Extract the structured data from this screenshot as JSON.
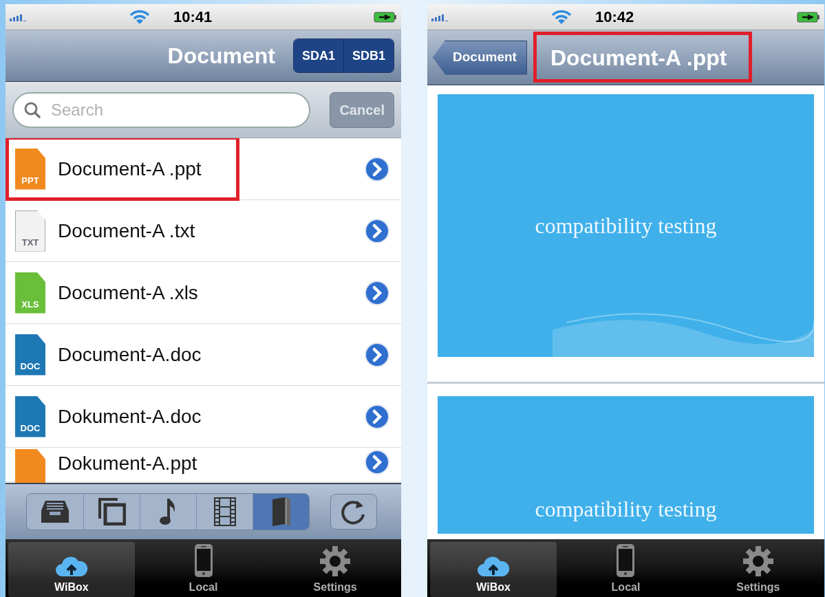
{
  "screens": [
    {
      "kind": "list",
      "status_bar": {
        "time": "10:41"
      },
      "nav_bar": {
        "title": "Document",
        "segments": [
          {
            "label": "SDA1",
            "selected": false
          },
          {
            "label": "SDB1",
            "selected": false
          }
        ]
      },
      "search": {
        "placeholder": "Search",
        "cancel": "Cancel"
      },
      "files": [
        {
          "name": "Document-A .ppt",
          "kind": "ppt",
          "badge": "PPT",
          "highlighted": true
        },
        {
          "name": "Document-A .txt",
          "kind": "txt",
          "badge": "TXT",
          "highlighted": false
        },
        {
          "name": "Document-A .xls",
          "kind": "xls",
          "badge": "XLS",
          "highlighted": false
        },
        {
          "name": "Document-A.doc",
          "kind": "doc",
          "badge": "DOC",
          "highlighted": false
        },
        {
          "name": "Dokument-A.doc",
          "kind": "doc",
          "badge": "DOC",
          "highlighted": false
        },
        {
          "name": "Dokument-A.ppt",
          "kind": "ppt",
          "highlighted": false
        }
      ],
      "toolbar": [
        {
          "kind": "inbox",
          "selected": false
        },
        {
          "kind": "photos",
          "selected": false
        },
        {
          "kind": "music",
          "selected": false
        },
        {
          "kind": "film",
          "selected": false
        },
        {
          "kind": "book",
          "selected": true
        }
      ],
      "tabs": [
        {
          "label": "WiBox",
          "kind": "cloud",
          "selected": true
        },
        {
          "label": "Local",
          "kind": "phone",
          "selected": false
        },
        {
          "label": "Settings",
          "kind": "gear",
          "selected": false
        }
      ]
    },
    {
      "kind": "viewer",
      "status_bar": {
        "time": "10:42"
      },
      "nav_bar": {
        "title": "Document-A .ppt",
        "back": "Document",
        "highlighted": true
      },
      "slides": [
        {
          "text": "compatibility testing"
        },
        {
          "text": "compatibility testing"
        }
      ],
      "tabs": [
        {
          "label": "WiBox",
          "kind": "cloud",
          "selected": true
        },
        {
          "label": "Local",
          "kind": "phone",
          "selected": false
        },
        {
          "label": "Settings",
          "kind": "gear",
          "selected": false
        }
      ]
    }
  ]
}
